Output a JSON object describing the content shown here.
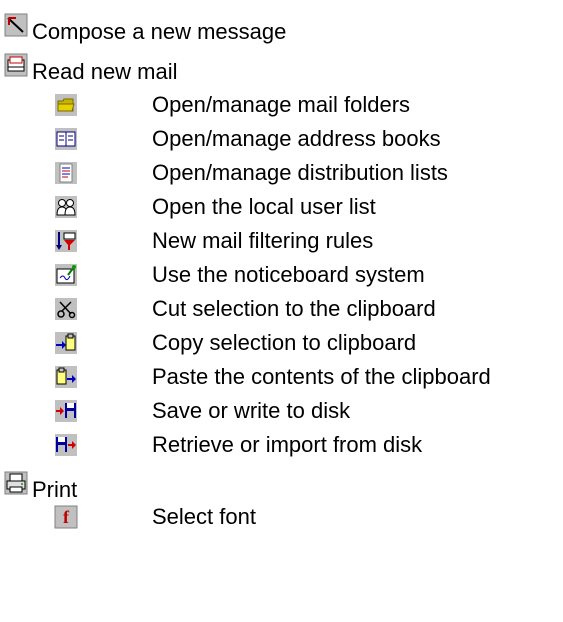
{
  "items": [
    {
      "label": "Compose a new message",
      "icon": "compose-icon"
    },
    {
      "label": "Read new mail",
      "icon": "read-mail-icon"
    },
    {
      "label": "Open/manage mail folders",
      "icon": "folder-icon"
    },
    {
      "label": "Open/manage address books",
      "icon": "address-book-icon"
    },
    {
      "label": "Open/manage distribution lists",
      "icon": "distribution-list-icon"
    },
    {
      "label": "Open the local user list",
      "icon": "user-list-icon"
    },
    {
      "label": "New mail filtering rules",
      "icon": "filter-icon"
    },
    {
      "label": "Use the noticeboard system",
      "icon": "noticeboard-icon"
    },
    {
      "label": "Cut selection to the clipboard",
      "icon": "cut-icon"
    },
    {
      "label": "Copy selection to clipboard",
      "icon": "copy-icon"
    },
    {
      "label": "Paste the contents of the clipboard",
      "icon": "paste-icon"
    },
    {
      "label": "Save or write to disk",
      "icon": "save-disk-icon"
    },
    {
      "label": "Retrieve or import from disk",
      "icon": "retrieve-disk-icon"
    },
    {
      "label": "Print",
      "icon": "print-icon"
    },
    {
      "label": "Select font",
      "icon": "font-icon"
    }
  ]
}
